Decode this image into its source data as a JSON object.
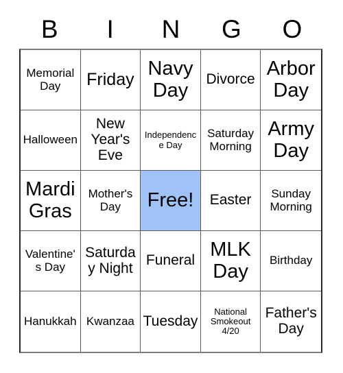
{
  "header": {
    "letters": [
      "B",
      "I",
      "N",
      "G",
      "O"
    ]
  },
  "grid": {
    "columns": 5,
    "rows": 5,
    "free_space_color": "#9fc2f7",
    "cells": [
      {
        "label": "Memorial Day",
        "size": "sm",
        "free": false
      },
      {
        "label": "Friday",
        "size": "lg",
        "free": false
      },
      {
        "label": "Navy Day",
        "size": "xl",
        "free": false
      },
      {
        "label": "Divorce",
        "size": "md",
        "free": false
      },
      {
        "label": "Arbor Day",
        "size": "xl",
        "free": false
      },
      {
        "label": "Halloween",
        "size": "sm",
        "free": false
      },
      {
        "label": "New Year's Eve",
        "size": "md",
        "free": false
      },
      {
        "label": "Independence Day",
        "size": "xs",
        "free": false
      },
      {
        "label": "Saturday Morning",
        "size": "sm",
        "free": false
      },
      {
        "label": "Army Day",
        "size": "xl",
        "free": false
      },
      {
        "label": "Mardi Gras",
        "size": "xl",
        "free": false
      },
      {
        "label": "Mother's Day",
        "size": "sm",
        "free": false
      },
      {
        "label": "Free!",
        "size": "xl",
        "free": true
      },
      {
        "label": "Easter",
        "size": "md",
        "free": false
      },
      {
        "label": "Sunday Morning",
        "size": "sm",
        "free": false
      },
      {
        "label": "Valentine's Day",
        "size": "sm",
        "free": false
      },
      {
        "label": "Saturday Night",
        "size": "md",
        "free": false
      },
      {
        "label": "Funeral",
        "size": "md",
        "free": false
      },
      {
        "label": "MLK Day",
        "size": "xl",
        "free": false
      },
      {
        "label": "Birthday",
        "size": "sm",
        "free": false
      },
      {
        "label": "Hanukkah",
        "size": "sm",
        "free": false
      },
      {
        "label": "Kwanzaa",
        "size": "sm",
        "free": false
      },
      {
        "label": "Tuesday",
        "size": "md",
        "free": false
      },
      {
        "label": "National Smokeout 4/20",
        "size": "xs",
        "free": false
      },
      {
        "label": "Father's Day",
        "size": "md",
        "free": false
      }
    ]
  }
}
